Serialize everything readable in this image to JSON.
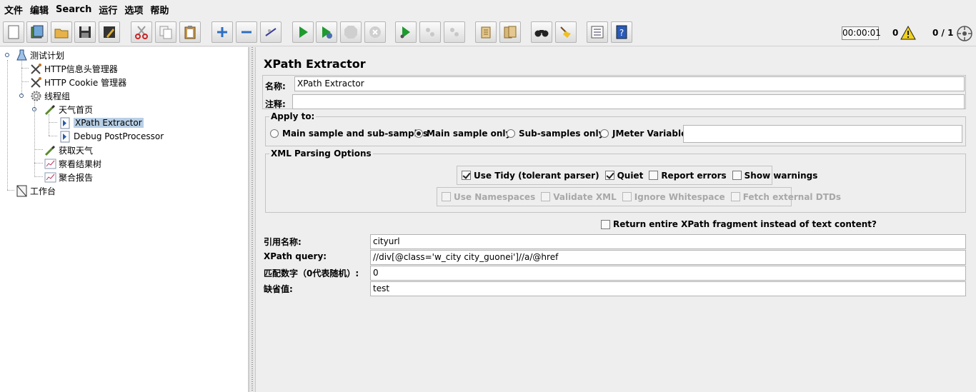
{
  "menubar": {
    "items": [
      "文件",
      "编辑",
      "Search",
      "运行",
      "选项",
      "帮助"
    ]
  },
  "toolbar": {
    "buttons": [
      "new",
      "templates",
      "open",
      "save",
      "save-as",
      "cut",
      "copy",
      "paste",
      "expand",
      "collapse",
      "toggle",
      "start",
      "start-no-pauses",
      "stop",
      "shutdown",
      "remote-start",
      "remote-stop",
      "remote-exit",
      "clear",
      "clear-all",
      "search",
      "reset-search",
      "function-helper",
      "help"
    ],
    "timer": "00:00:01",
    "error_count": "0",
    "thread_count": "0 / 1"
  },
  "tree": {
    "nodes": [
      {
        "label": "测试计划",
        "icon": "test-plan-icon"
      },
      {
        "label": "HTTP信息头管理器",
        "icon": "wrench-icon"
      },
      {
        "label": "HTTP Cookie 管理器",
        "icon": "wrench-icon"
      },
      {
        "label": "线程组",
        "icon": "gear-icon"
      },
      {
        "label": "天气首页",
        "icon": "pipette-icon"
      },
      {
        "label": "XPath Extractor",
        "icon": "postprocessor-icon"
      },
      {
        "label": "Debug PostProcessor",
        "icon": "postprocessor-icon"
      },
      {
        "label": "获取天气",
        "icon": "pipette-icon"
      },
      {
        "label": "察看结果树",
        "icon": "graph-icon"
      },
      {
        "label": "聚合报告",
        "icon": "graph-icon"
      },
      {
        "label": "工作台",
        "icon": "workbench-icon"
      }
    ]
  },
  "panel": {
    "title": "XPath Extractor",
    "name_label": "名称:",
    "name_value": "XPath Extractor",
    "comment_label": "注释:",
    "comment_value": "",
    "apply_to": {
      "title": "Apply to:",
      "options": [
        "Main sample and sub-samples",
        "Main sample only",
        "Sub-samples only",
        "JMeter Variable"
      ],
      "selected": "Main sample only",
      "variable_value": ""
    },
    "xml_parsing": {
      "title": "XML Parsing Options",
      "row1": [
        {
          "label": "Use Tidy (tolerant parser)",
          "checked": true
        },
        {
          "label": "Quiet",
          "checked": true
        },
        {
          "label": "Report errors",
          "checked": false
        },
        {
          "label": "Show warnings",
          "checked": false
        }
      ],
      "row2": [
        {
          "label": "Use Namespaces",
          "checked": false
        },
        {
          "label": "Validate XML",
          "checked": false
        },
        {
          "label": "Ignore Whitespace",
          "checked": false
        },
        {
          "label": "Fetch external DTDs",
          "checked": false
        }
      ]
    },
    "return_fragment": {
      "label": "Return entire XPath fragment instead of text content?",
      "checked": false
    },
    "fields": [
      {
        "label": "引用名称:",
        "value": "cityurl"
      },
      {
        "label": "XPath query:",
        "value": "//div[@class='w_city city_guonei']//a/@href"
      },
      {
        "label": "匹配数字（0代表随机）:",
        "value": "0"
      },
      {
        "label": "缺省值:",
        "value": "test"
      }
    ]
  }
}
